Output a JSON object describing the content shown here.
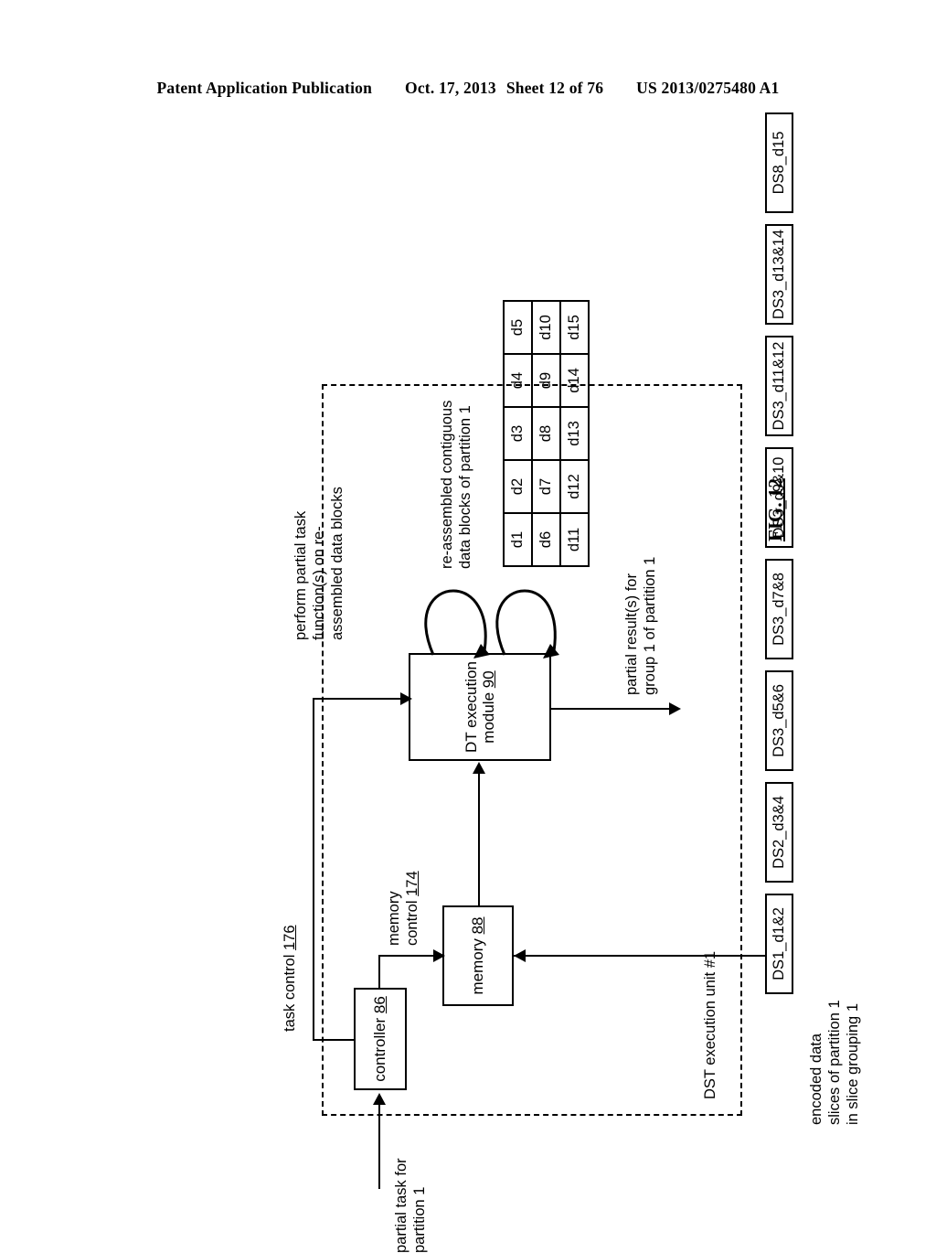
{
  "header": {
    "publication": "Patent Application Publication",
    "date": "Oct. 17, 2013",
    "sheet": "Sheet 12 of 76",
    "number": "US 2013/0275480 A1"
  },
  "figure": {
    "caption": "FIG. 12",
    "unit_boundary_label": "DST execution unit #1"
  },
  "blocks": {
    "dt_execution_module": "DT execution\nmodule ",
    "dt_execution_module_ref": "90",
    "memory": "memory ",
    "memory_ref": "88",
    "controller": "controller ",
    "controller_ref": "86"
  },
  "signals": {
    "memory_control": "memory\ncontrol ",
    "memory_control_ref": "174",
    "task_control": "task control ",
    "task_control_ref": "176",
    "partial_result": "partial result(s) for\ngroup 1 of partition 1",
    "partial_task": "partial task for\npartition 1"
  },
  "annotations": {
    "perform_task": "perform partial task\nfunction(s) on re-\nassembled data blocks",
    "reassembled_blocks": "re-assembled contiguous\ndata blocks of partition 1",
    "encoded_slices": "encoded data\nslices of partition 1\nin slice grouping 1"
  },
  "data_blocks": {
    "rows": [
      [
        "d1",
        "d2",
        "d3",
        "d4",
        "d5"
      ],
      [
        "d6",
        "d7",
        "d8",
        "d9",
        "d10"
      ],
      [
        "d11",
        "d12",
        "d13",
        "d14",
        "d15"
      ]
    ]
  },
  "slices": [
    "DS1_d1&2",
    "DS2_d3&4",
    "DS3_d5&6",
    "DS3_d7&8",
    "DS3_d9&10",
    "DS3_d11&12",
    "DS3_d13&14",
    "DS8_d15"
  ]
}
